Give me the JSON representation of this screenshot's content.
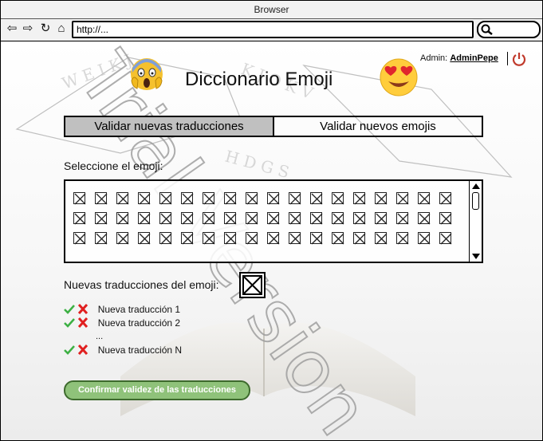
{
  "browser": {
    "title": "Browser",
    "url": "http://...",
    "icons": [
      "back-icon",
      "forward-icon",
      "reload-icon",
      "home-icon",
      "search-icon"
    ]
  },
  "app": {
    "title": "Diccionario Emoji",
    "left_emoji": "screaming-face",
    "right_emoji": "heart-eyes-face"
  },
  "admin": {
    "prefix": "Admin:",
    "username": "AdminPepe",
    "logout_icon": "power-icon"
  },
  "tabs": [
    {
      "label": "Validar nuevas traducciones",
      "active": true
    },
    {
      "label": "Validar nuevos emojis",
      "active": false
    }
  ],
  "emoji_picker": {
    "label": "Seleccione el emoji:",
    "rows": 3,
    "columns": 18
  },
  "translations": {
    "label": "Nuevas traducciones del emoji:",
    "items": [
      {
        "text": "Nueva traducción 1"
      },
      {
        "text": "Nueva traducción 2"
      },
      {
        "text": "Nueva traducción N"
      }
    ],
    "ellipsis": "..."
  },
  "confirm_button": "Confirmar validez de las traducciones",
  "watermark": "Trial Version",
  "colors": {
    "accept": "#3cb043",
    "reject": "#e02020",
    "confirm_bg": "#8fc27a",
    "power": "#c0392b",
    "tab_active": "#c0c0c0"
  }
}
